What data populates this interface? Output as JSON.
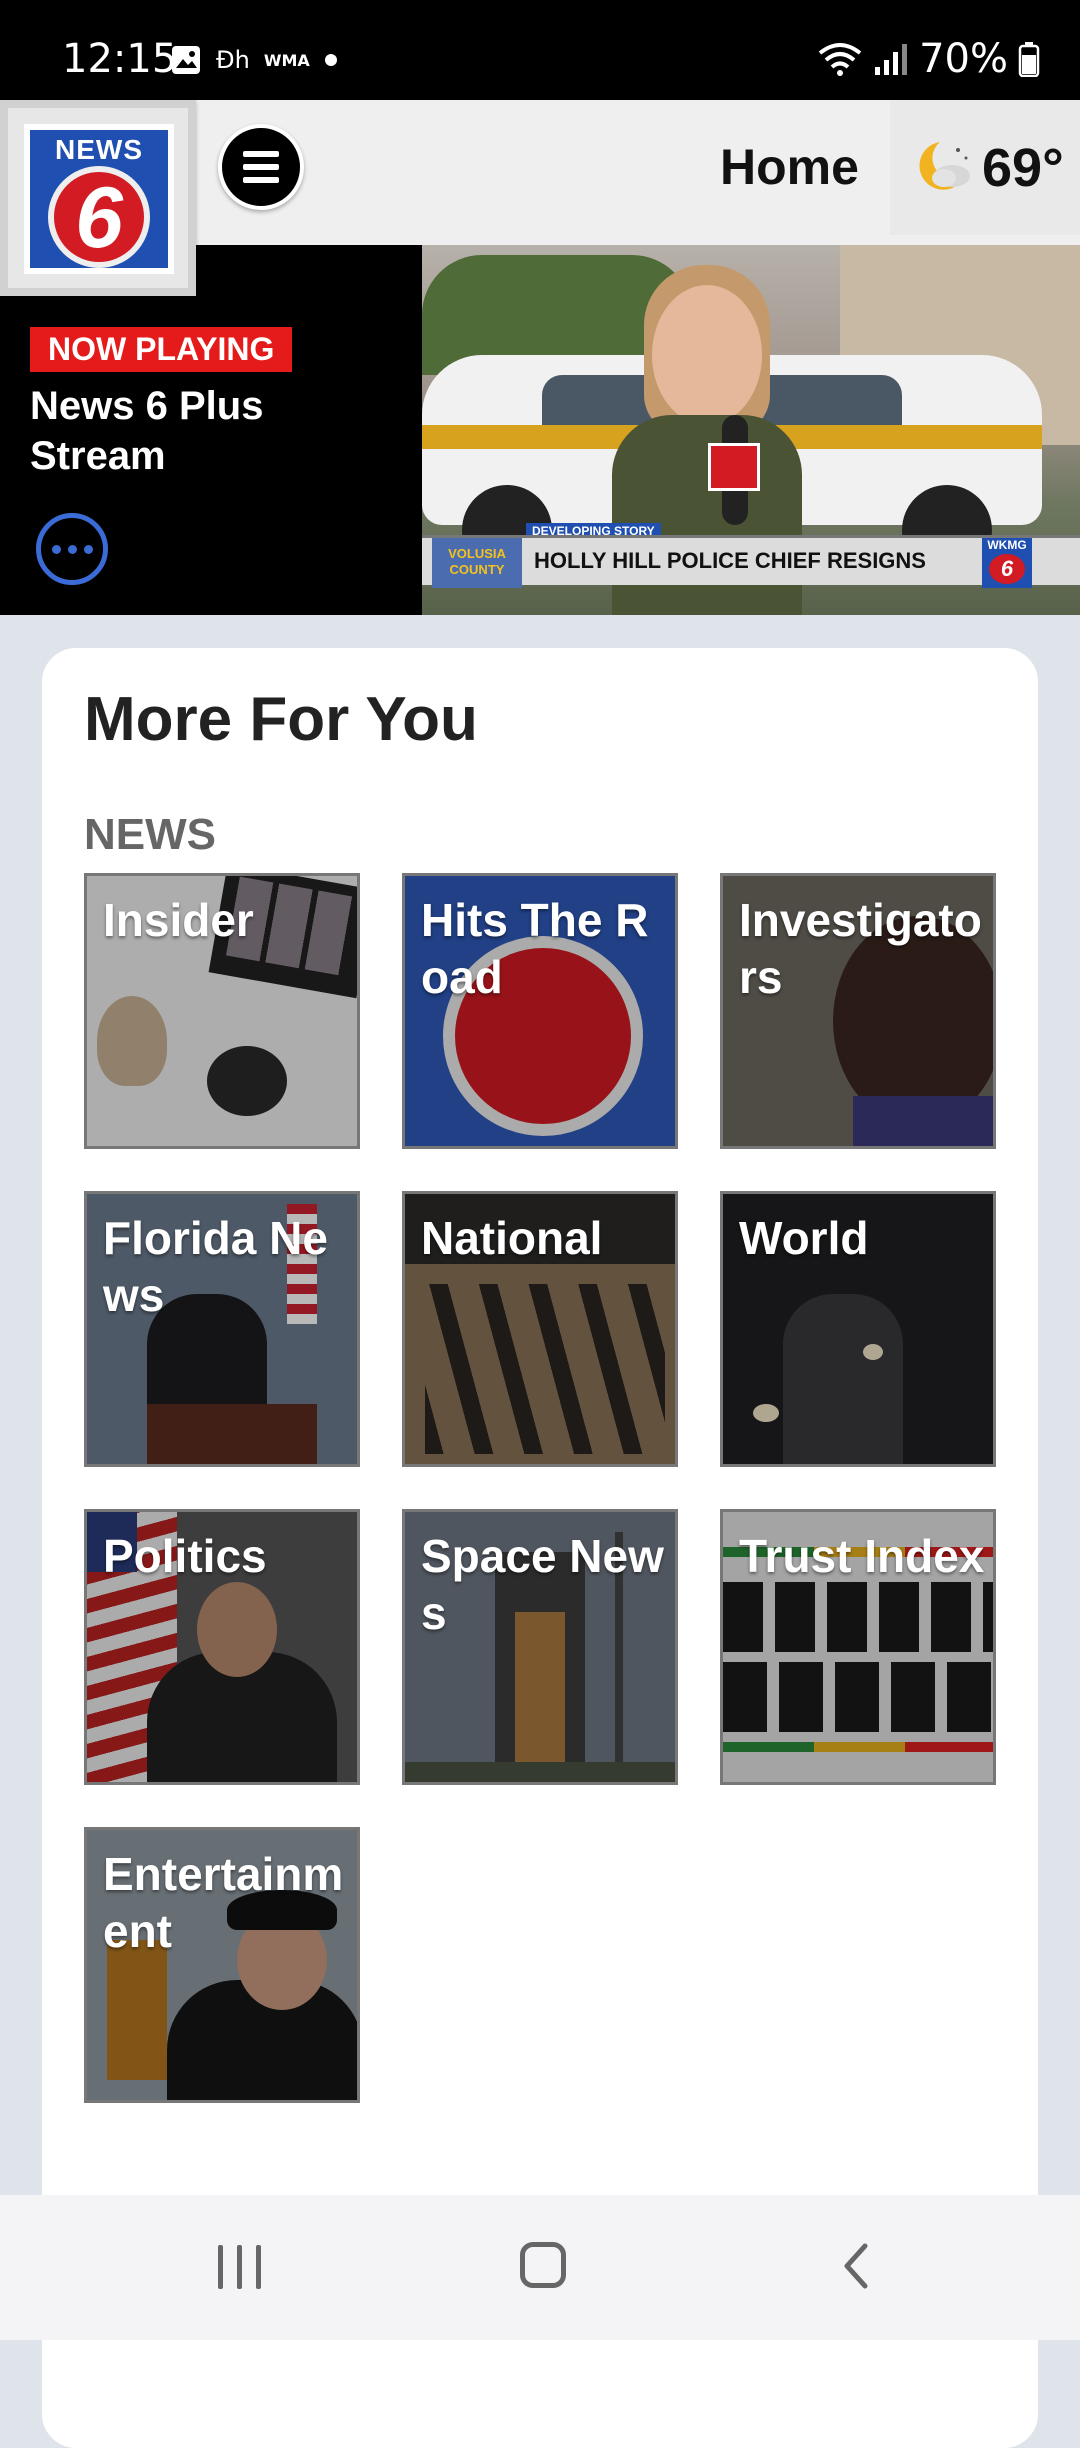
{
  "status_bar": {
    "time": "12:15",
    "left_icons": [
      "image-icon",
      "notification-icon",
      "notification-icon",
      "dot-icon"
    ],
    "small_label_1": "Ðh",
    "small_label_2": "WMA",
    "battery": "70%"
  },
  "header": {
    "logo_text": "NEWS",
    "logo_numeral": "6",
    "title": "Home",
    "weather_temp": "69°"
  },
  "now_playing": {
    "badge": "NOW PLAYING",
    "title": "News 6 Plus Stream"
  },
  "video": {
    "dev_story": "DEVELOPING STORY",
    "county": "VOLUSIA COUNTY",
    "headline": "HOLLY HILL POLICE CHIEF RESIGNS",
    "station": "WKMG"
  },
  "section": {
    "title": "More For You",
    "label": "NEWS",
    "tiles": [
      {
        "label": "Insider"
      },
      {
        "label": "Hits The Road"
      },
      {
        "label": "Investigators"
      },
      {
        "label": "Florida News"
      },
      {
        "label": "National"
      },
      {
        "label": "World"
      },
      {
        "label": "Politics"
      },
      {
        "label": "Space News"
      },
      {
        "label": "Trust Index"
      },
      {
        "label": "Entertainment"
      }
    ]
  },
  "colors": {
    "accent_red": "#e51b1b",
    "brand_blue": "#1f4fb0",
    "more_button": "#3b6bd6"
  }
}
